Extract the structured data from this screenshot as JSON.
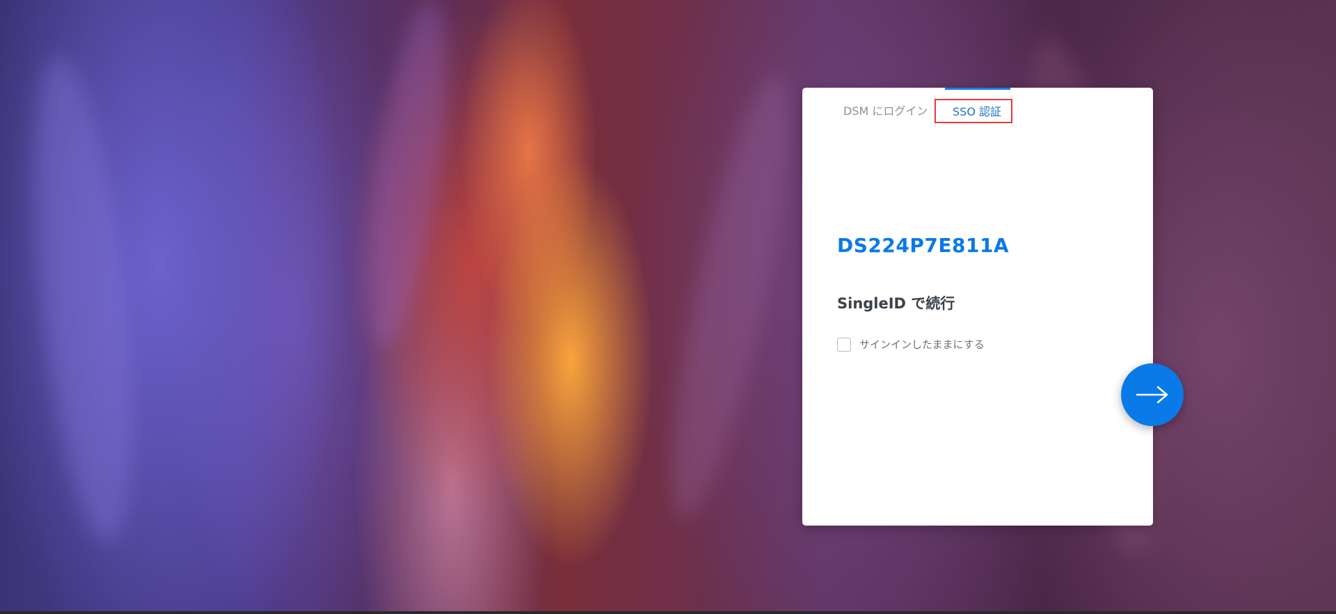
{
  "tabs": {
    "login_label": "DSM にログイン",
    "sso_label": "SSO 認証"
  },
  "card": {
    "hostname": "DS224P7E811A",
    "continue_title": "SingleID で続行",
    "stay_signed_in_label": "サインインしたままにする",
    "stay_signed_in_checked": false
  },
  "icons": {
    "next": "arrow-right-icon"
  },
  "colors": {
    "accent": "#0a7ae8",
    "highlight_box": "#e53935",
    "card_background": "#ffffff"
  }
}
